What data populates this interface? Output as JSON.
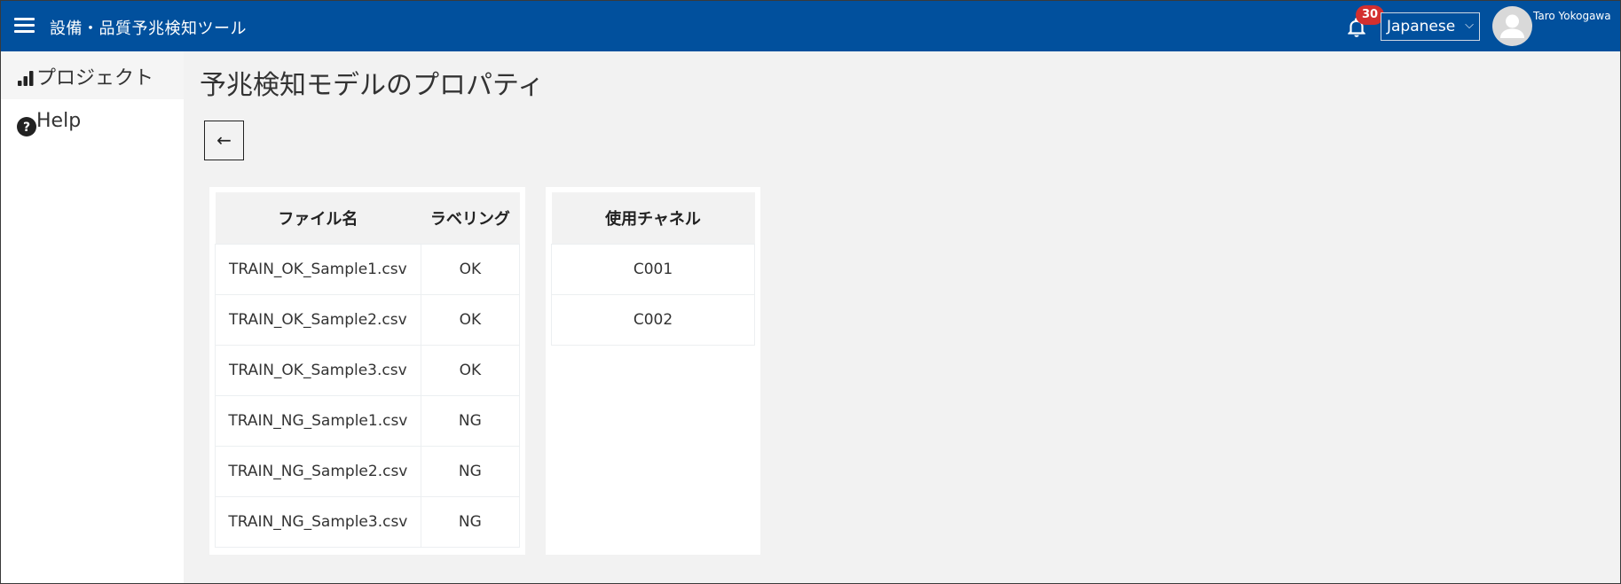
{
  "header": {
    "app_title": "設備・品質予兆検知ツール",
    "notification_count": "30",
    "language": "Japanese",
    "user_name": "Taro Yokogawa",
    "brand_color": "#01509d",
    "badge_color": "#d32f2f"
  },
  "sidebar": {
    "items": [
      {
        "label": "プロジェクト",
        "icon": "bar-chart-icon",
        "active": true
      },
      {
        "label": "Help",
        "icon": "help-circle-icon",
        "active": false
      }
    ]
  },
  "main": {
    "page_title": "予兆検知モデルのプロパティ",
    "back_label": "←",
    "files_table": {
      "headers": {
        "file": "ファイル名",
        "label": "ラベリング"
      },
      "rows": [
        {
          "file": "TRAIN_OK_Sample1.csv",
          "label": "OK"
        },
        {
          "file": "TRAIN_OK_Sample2.csv",
          "label": "OK"
        },
        {
          "file": "TRAIN_OK_Sample3.csv",
          "label": "OK"
        },
        {
          "file": "TRAIN_NG_Sample1.csv",
          "label": "NG"
        },
        {
          "file": "TRAIN_NG_Sample2.csv",
          "label": "NG"
        },
        {
          "file": "TRAIN_NG_Sample3.csv",
          "label": "NG"
        }
      ]
    },
    "channels_table": {
      "header": "使用チャネル",
      "rows": [
        "C001",
        "C002"
      ]
    }
  }
}
